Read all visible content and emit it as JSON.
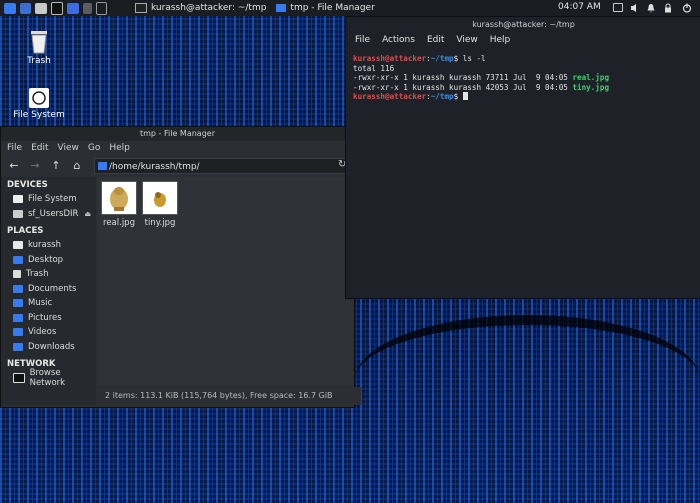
{
  "panel": {
    "terminal_task": "kurassh@attacker: ~/tmp",
    "filemanager_task": "tmp - File Manager",
    "clock": "04:07 AM",
    "icons": [
      "app-menu-icon",
      "show-desktop-icon",
      "file-manager-icon",
      "terminal-icon",
      "browser-icon",
      "workspace-1-icon",
      "workspace-2-icon"
    ]
  },
  "desktop": {
    "trash_label": "Trash",
    "filesystem_label": "File System"
  },
  "file_manager": {
    "title": "tmp - File Manager",
    "menu": [
      "File",
      "Edit",
      "View",
      "Go",
      "Help"
    ],
    "path": "/home/kurassh/tmp/",
    "sections": {
      "devices": "DEVICES",
      "places": "PLACES",
      "network": "NETWORK"
    },
    "devices": [
      "File System",
      "sf_UsersDIR"
    ],
    "places": [
      "kurassh",
      "Desktop",
      "Trash",
      "Documents",
      "Music",
      "Pictures",
      "Videos",
      "Downloads"
    ],
    "network": [
      "Browse Network"
    ],
    "files": [
      {
        "name": "real.jpg"
      },
      {
        "name": "tiny.jpg"
      }
    ],
    "status": "2 items: 113.1 KiB (115,764 bytes), Free space: 16.7 GiB"
  },
  "terminal": {
    "title": "kurassh@attacker: ~/tmp",
    "menu": [
      "File",
      "Actions",
      "Edit",
      "View",
      "Help"
    ],
    "prompt_user": "kurassh@attacker",
    "prompt_sep": ":",
    "prompt_path": "~/tmp",
    "prompt_end": "$",
    "command": " ls -l",
    "total": "total 116",
    "rows": [
      {
        "meta": "-rwxr-xr-x 1 kurassh kurassh 73711 Jul  9 04:05 ",
        "file": "real.jpg"
      },
      {
        "meta": "-rwxr-xr-x 1 kurassh kurassh 42053 Jul  9 04:05 ",
        "file": "tiny.jpg"
      }
    ]
  },
  "colors": {
    "prompt_user": "#e34a4a",
    "prompt_path": "#3b8eea",
    "file_name": "#3fd16b",
    "accent": "#367bf0"
  }
}
